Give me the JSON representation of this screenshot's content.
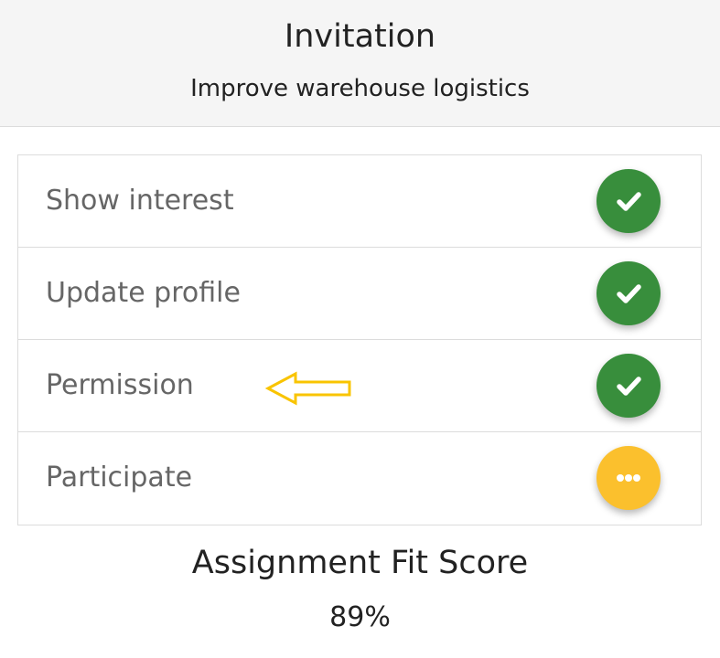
{
  "header": {
    "title": "Invitation",
    "subtitle": "Improve warehouse logistics"
  },
  "steps": [
    {
      "label": "Show interest",
      "status": "done",
      "icon": "check-icon"
    },
    {
      "label": "Update profile",
      "status": "done",
      "icon": "check-icon"
    },
    {
      "label": "Permission",
      "status": "done",
      "icon": "check-icon",
      "annotation": "arrow-left-icon"
    },
    {
      "label": "Participate",
      "status": "pending",
      "icon": "ellipsis-icon"
    }
  ],
  "score": {
    "title": "Assignment Fit Score",
    "value": "89%"
  },
  "colors": {
    "done": "#388e3c",
    "pending": "#fbc02d",
    "annotation_arrow": "#f9c400",
    "header_bg": "#f5f5f5"
  }
}
